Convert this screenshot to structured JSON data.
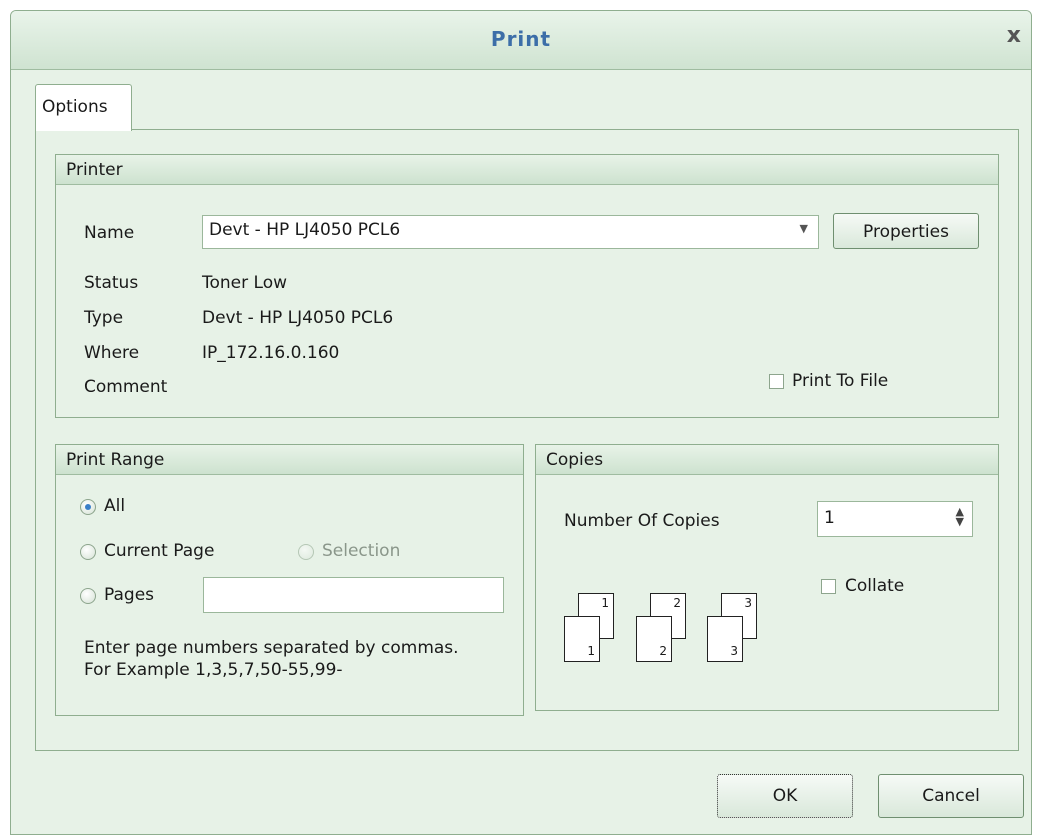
{
  "window": {
    "title": "Print",
    "close_label": "x"
  },
  "tabs": [
    {
      "label": "Options"
    }
  ],
  "printer": {
    "group_label": "Printer",
    "name_label": "Name",
    "name_value": "Devt - HP LJ4050 PCL6",
    "properties_label": "Properties",
    "status_label": "Status",
    "status_value": "Toner Low",
    "type_label": "Type",
    "type_value": "Devt - HP LJ4050 PCL6",
    "where_label": "Where",
    "where_value": "IP_172.16.0.160",
    "comment_label": "Comment",
    "comment_value": "",
    "print_to_file_label": "Print To File",
    "print_to_file_checked": false
  },
  "print_range": {
    "group_label": "Print Range",
    "all_label": "All",
    "current_page_label": "Current Page",
    "selection_label": "Selection",
    "pages_label": "Pages",
    "pages_value": "",
    "selected": "all",
    "hint_line1": "Enter page numbers separated by commas.",
    "hint_line2": "For Example 1,3,5,7,50-55,99-"
  },
  "copies": {
    "group_label": "Copies",
    "number_label": "Number Of Copies",
    "number_value": "1",
    "collate_label": "Collate",
    "collate_checked": false,
    "page_numbers": [
      "1",
      "1",
      "2",
      "2",
      "3",
      "3"
    ]
  },
  "buttons": {
    "ok_label": "OK",
    "cancel_label": "Cancel"
  },
  "colors": {
    "title": "#3c6ea8",
    "background": "#e7f2e7",
    "border": "#8fae8f"
  }
}
